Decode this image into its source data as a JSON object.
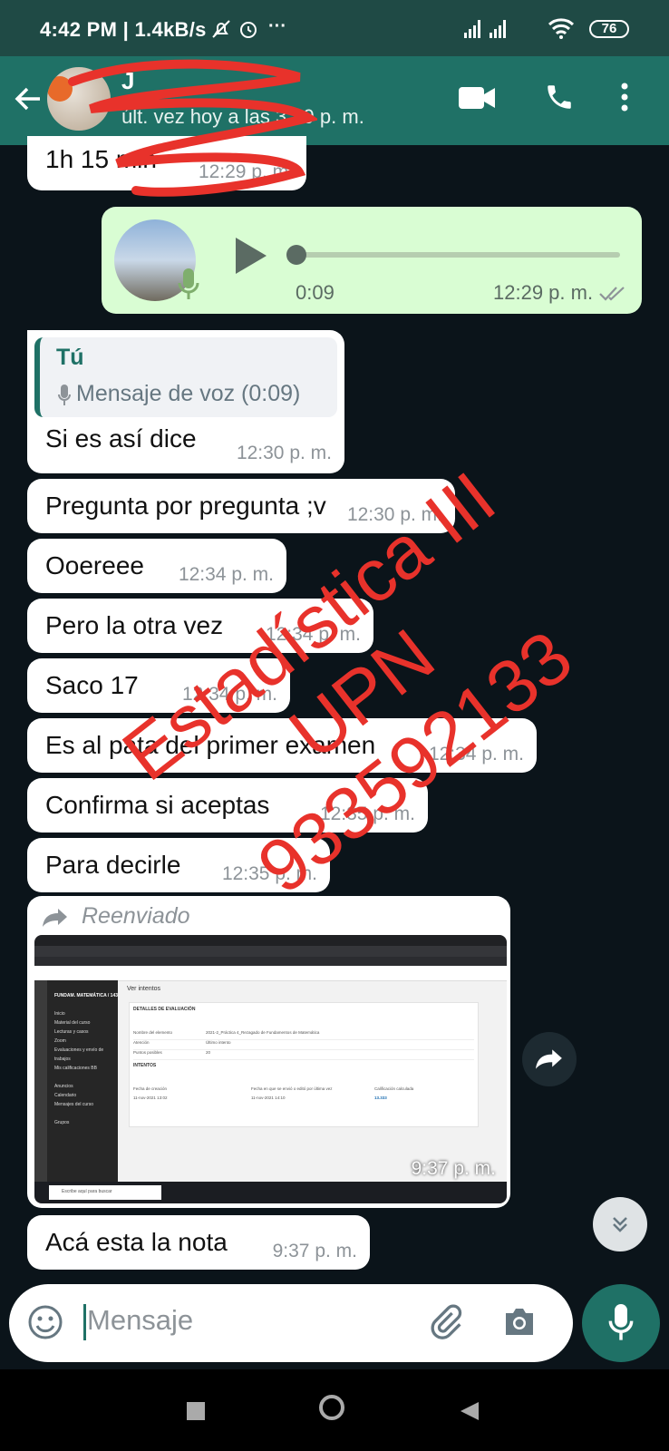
{
  "status": {
    "time": "4:42 PM | 1.4kB/s",
    "battery": "76"
  },
  "header": {
    "name": "J",
    "last_seen": "últ. vez hoy a las 3:19 p. m."
  },
  "messages": [
    {
      "text": "1h 15 min",
      "time": "12:29 p. m."
    },
    {
      "voice_duration": "0:09",
      "time": "12:29 p. m."
    },
    {
      "quote_author": "Tú",
      "quote_text": "Mensaje de voz (0:09)",
      "text": "Si es así dice",
      "time": "12:30 p. m."
    },
    {
      "text": "Pregunta por pregunta ;v",
      "time": "12:30 p. m."
    },
    {
      "text": "Ooereee",
      "time": "12:34 p. m."
    },
    {
      "text": "Pero la otra vez",
      "time": "12:34 p. m."
    },
    {
      "text": "Saco 17",
      "time": "12:34 p. m."
    },
    {
      "text": "Es al pata del primer examen",
      "time": "12:34 p. m."
    },
    {
      "text": "Confirma si aceptas",
      "time": "12:35 p. m."
    },
    {
      "text": "Para decirle",
      "time": "12:35 p. m."
    },
    {
      "forwarded_label": "Reenviado",
      "time": "9:37 p. m."
    },
    {
      "text": "Acá esta la nota",
      "time": "9:37 p. m."
    }
  ],
  "screenshot": {
    "course_title": "FUNDAM. MATEMÁTICA / 143",
    "page_title": "Ver intentos",
    "section": "DETALLES DE EVALUACIÓN",
    "rows": [
      {
        "label": "Nombre del elemento",
        "value": "2021-2_Práctica 4_Rezagado de Fundamentos de Matemática"
      },
      {
        "label": "Atención",
        "value": "Último intento"
      },
      {
        "label": "Puntos posibles",
        "value": "20"
      }
    ],
    "attempts_heading": "INTENTOS",
    "col_headers": [
      "Fecha de creación",
      "Fecha en que se envió o editó por última vez",
      "Calificación calculada"
    ],
    "attempt": [
      "11-nov-2021 13:02",
      "11-nov-2021 14:10",
      "13.333"
    ],
    "menu": [
      "Inicio",
      "Material del curso",
      "Lecturas y casos",
      "Zoom",
      "Evaluaciones y envío de trabajos",
      "Mis calificaciones BB",
      "Anuncios",
      "Calendario",
      "Mensajes del curso",
      "Grupos"
    ],
    "taskbar_search": "Escribe aquí para buscar"
  },
  "watermark": {
    "line1": "Estadística III",
    "line2": "UPN",
    "line3": "933592133"
  },
  "input": {
    "placeholder": "Mensaje"
  },
  "colors": {
    "header": "#1f7166",
    "bubble_out": "#d9fdd3",
    "bubble_in": "#ffffff",
    "background": "#0b141a",
    "watermark": "#e8322b"
  }
}
